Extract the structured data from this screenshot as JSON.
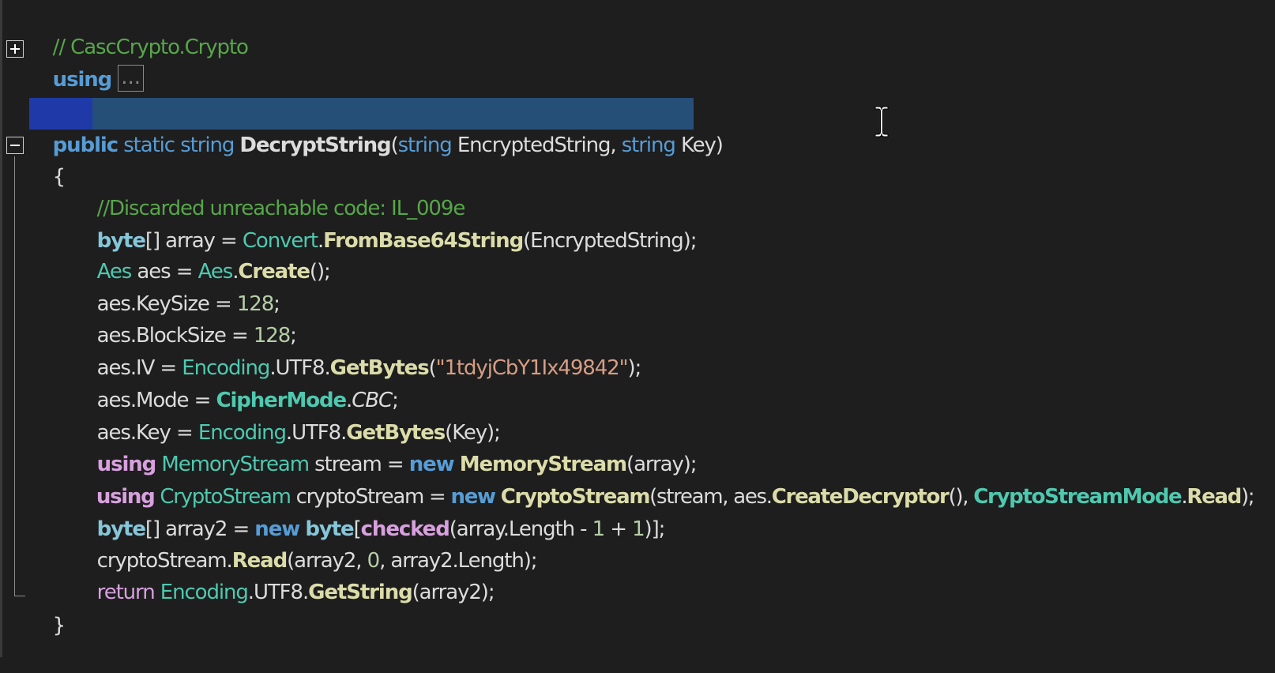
{
  "editor": {
    "header_comment": "// CascCrypto.Crypto",
    "using_keyword": "using",
    "collapsed_marker": "...",
    "signature": {
      "public": "public",
      "static": "static",
      "string1": "string",
      "method": "DecryptString",
      "paren_open": "(",
      "string2": "string",
      "param1": "EncryptedString,",
      "string3": "string",
      "param2": "Key)"
    },
    "open_brace": "{",
    "close_brace": "}",
    "lines": {
      "l1": {
        "comment": "//Discarded unreachable code: IL_009e"
      },
      "l2": {
        "t1": "byte",
        "t2": "[] array = ",
        "t3": "Convert",
        "t4": ".",
        "t5": "FromBase64String",
        "t6": "(EncryptedString);"
      },
      "l3": {
        "t1": "Aes",
        "t2": " aes = ",
        "t3": "Aes",
        "t4": ".",
        "t5": "Create",
        "t6": "();"
      },
      "l4": {
        "t1": "aes.KeySize = ",
        "t2": "128",
        "t3": ";"
      },
      "l5": {
        "t1": "aes.BlockSize = ",
        "t2": "128",
        "t3": ";"
      },
      "l6": {
        "t1": "aes.IV = ",
        "t2": "Encoding",
        "t3": ".UTF8.",
        "t4": "GetBytes",
        "t5": "(",
        "t6": "\"1tdyjCbY1Ix49842\"",
        "t7": ");"
      },
      "l7": {
        "t1": "aes.Mode = ",
        "t2": "CipherMode",
        "t3": ".",
        "t4": "CBC",
        "t5": ";"
      },
      "l8": {
        "t1": "aes.Key = ",
        "t2": "Encoding",
        "t3": ".UTF8.",
        "t4": "GetBytes",
        "t5": "(Key);"
      },
      "l9": {
        "t1": "using",
        "t2": " ",
        "t3": "MemoryStream",
        "t4": " stream = ",
        "t5": "new",
        "t6": " ",
        "t7": "MemoryStream",
        "t8": "(array);"
      },
      "l10": {
        "t1": "using",
        "t2": " ",
        "t3": "CryptoStream",
        "t4": " cryptoStream = ",
        "t5": "new",
        "t6": " ",
        "t7": "CryptoStream",
        "t8": "(stream, aes.",
        "t9": "CreateDecryptor",
        "t10": "(), ",
        "t11": "CryptoStreamMode",
        "t12": ".",
        "t13": "Read",
        "t14": ");"
      },
      "l11": {
        "t1": "byte",
        "t2": "[] array2 = ",
        "t3": "new",
        "t4": " ",
        "t5": "byte",
        "t6": "[",
        "t7": "checked",
        "t8": "(array.Length - ",
        "t9": "1",
        "t10": " + ",
        "t11": "1",
        "t12": ")];"
      },
      "l12": {
        "t1": "cryptoStream.",
        "t2": "Read",
        "t3": "(array2, ",
        "t4": "0",
        "t5": ", array2.Length);"
      },
      "l13": {
        "t1": "return",
        "t2": " ",
        "t3": "Encoding",
        "t4": ".UTF8.",
        "t5": "GetString",
        "t6": "(array2);"
      }
    }
  },
  "icons": {
    "expand": "plus-box-icon",
    "collapse": "minus-box-icon",
    "cursor": "i-beam-cursor-icon"
  },
  "colors": {
    "background": "#1e1e1e",
    "comment": "#57a64a",
    "keyword": "#569cd6",
    "control_keyword": "#d8a0df",
    "type": "#4ec9b0",
    "method": "#dcdcaa",
    "number": "#b5cea8",
    "string": "#d69d85",
    "selection": "#264f78"
  }
}
